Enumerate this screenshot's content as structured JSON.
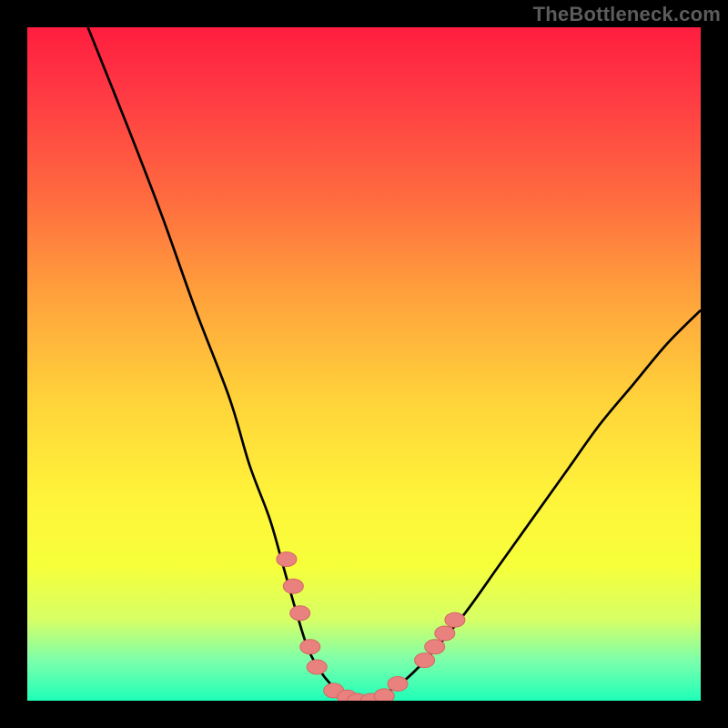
{
  "watermark": "TheBottleneck.com",
  "colors": {
    "frame": "#000000",
    "curve": "#000000",
    "marker_fill": "#e9817f",
    "marker_stroke": "#d66763",
    "gradient_stops": [
      "#ff1d3f",
      "#ff3a44",
      "#ff6a3f",
      "#ffa23c",
      "#ffd23a",
      "#fff43a",
      "#f6ff3a",
      "#d6ff66",
      "#7dffab",
      "#1effb8"
    ]
  },
  "chart_data": {
    "type": "line",
    "title": "",
    "xlabel": "",
    "ylabel": "",
    "xlim": [
      0,
      100
    ],
    "ylim": [
      0,
      100
    ],
    "grid": false,
    "legend": false,
    "series": [
      {
        "name": "bottleneck-curve",
        "x": [
          9,
          15,
          20,
          25,
          30,
          33,
          36,
          38,
          40,
          42,
          45,
          48,
          50,
          52,
          56,
          60,
          65,
          70,
          75,
          80,
          85,
          90,
          95,
          100
        ],
        "y": [
          100,
          85,
          72,
          58,
          45,
          35,
          27,
          20,
          13,
          7,
          2.5,
          0.5,
          0,
          0.5,
          3,
          7,
          13,
          20,
          27,
          34,
          41,
          47,
          53,
          58
        ]
      }
    ],
    "markers": [
      {
        "x": 38.5,
        "y": 21
      },
      {
        "x": 39.5,
        "y": 17
      },
      {
        "x": 40.5,
        "y": 13
      },
      {
        "x": 42,
        "y": 8
      },
      {
        "x": 43,
        "y": 5
      },
      {
        "x": 45.5,
        "y": 1.5
      },
      {
        "x": 47.5,
        "y": 0.5
      },
      {
        "x": 49,
        "y": 0
      },
      {
        "x": 51,
        "y": 0
      },
      {
        "x": 53,
        "y": 0.7
      },
      {
        "x": 55,
        "y": 2.5
      },
      {
        "x": 59,
        "y": 6
      },
      {
        "x": 60.5,
        "y": 8
      },
      {
        "x": 62,
        "y": 10
      },
      {
        "x": 63.5,
        "y": 12
      }
    ]
  }
}
